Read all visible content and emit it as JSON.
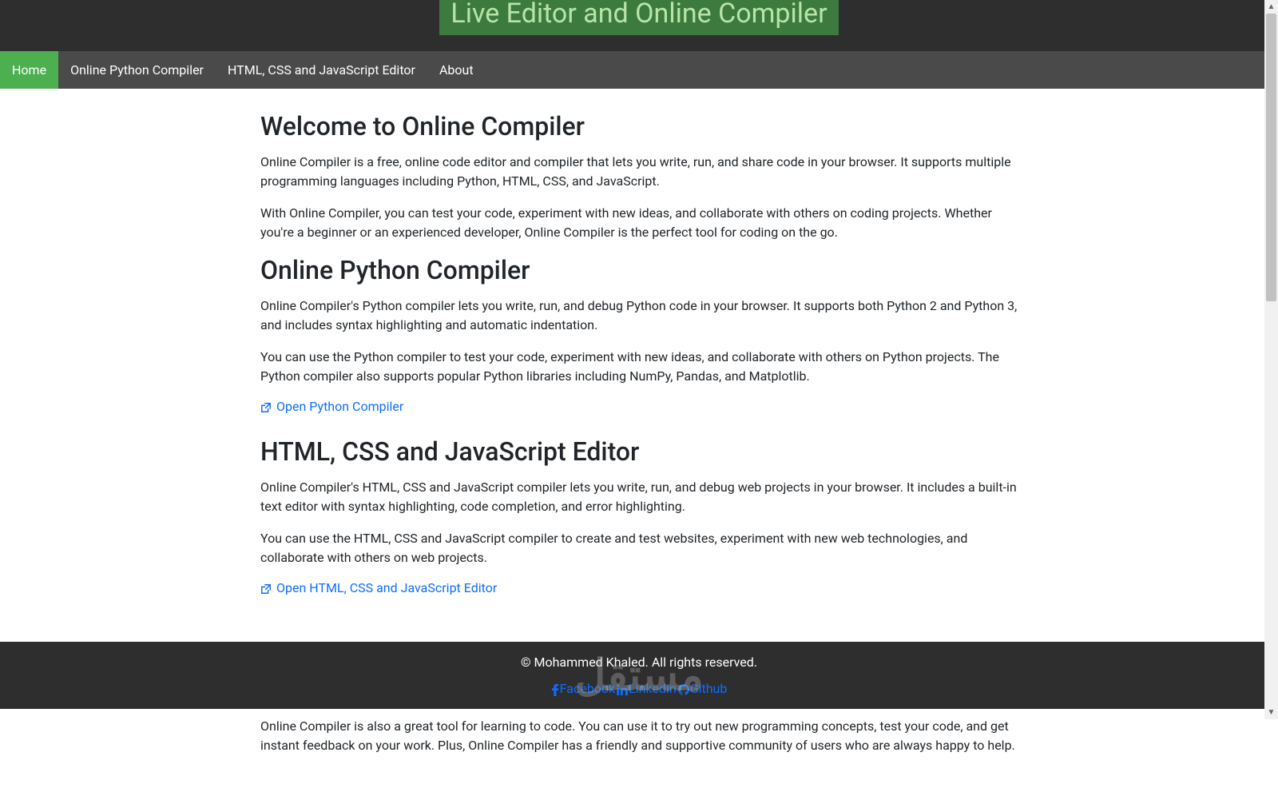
{
  "header": {
    "title": "Live Editor and Online Compiler"
  },
  "nav": {
    "items": [
      {
        "label": "Home",
        "active": true
      },
      {
        "label": "Online Python Compiler",
        "active": false
      },
      {
        "label": "HTML, CSS and JavaScript Editor",
        "active": false
      },
      {
        "label": "About",
        "active": false
      }
    ]
  },
  "sections": {
    "welcome": {
      "heading": "Welcome to Online Compiler",
      "p1": "Online Compiler is a free, online code editor and compiler that lets you write, run, and share code in your browser. It supports multiple programming languages including Python, HTML, CSS, and JavaScript.",
      "p2": "With Online Compiler, you can test your code, experiment with new ideas, and collaborate with others on coding projects. Whether you're a beginner or an experienced developer, Online Compiler is the perfect tool for coding on the go."
    },
    "python": {
      "heading": "Online Python Compiler",
      "p1": "Online Compiler's Python compiler lets you write, run, and debug Python code in your browser. It supports both Python 2 and Python 3, and includes syntax highlighting and automatic indentation.",
      "p2": "You can use the Python compiler to test your code, experiment with new ideas, and collaborate with others on Python projects. The Python compiler also supports popular Python libraries including NumPy, Pandas, and Matplotlib.",
      "link_label": "Open Python Compiler"
    },
    "html": {
      "heading": "HTML, CSS and JavaScript Editor",
      "p1": "Online Compiler's HTML, CSS and JavaScript compiler lets you write, run, and debug web projects in your browser. It includes a built-in text editor with syntax highlighting, code completion, and error highlighting.",
      "p2": "You can use the HTML, CSS and JavaScript compiler to create and test websites, experiment with new web technologies, and collaborate with others on web projects.",
      "link_label": "Open HTML, CSS and JavaScript Editor"
    },
    "about": {
      "p1": "Online Compiler is also a great tool for learning to code. You can use it to try out new programming concepts, test your code, and get instant feedback on your work. Plus, Online Compiler has a friendly and supportive community of users who are always happy to help."
    }
  },
  "footer": {
    "copyright": "© Mohammed Khaled. All rights reserved.",
    "links": [
      {
        "label": "Facebook"
      },
      {
        "label": "Linkedin"
      },
      {
        "label": "Github"
      }
    ],
    "watermark": "مستقل"
  }
}
